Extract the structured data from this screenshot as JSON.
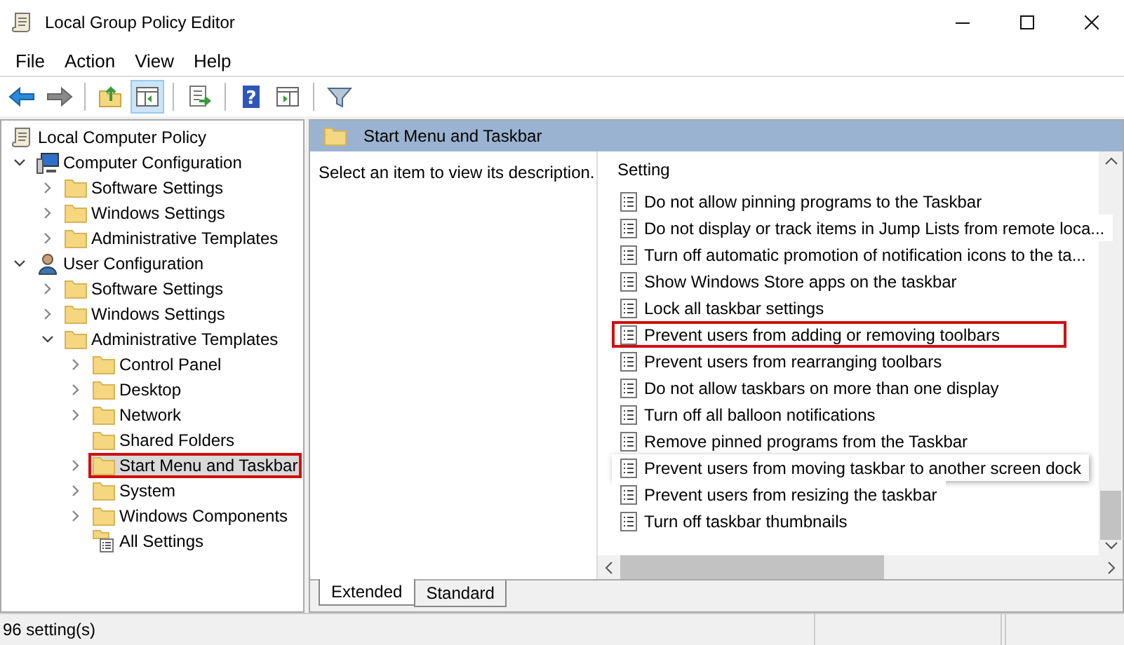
{
  "window": {
    "title": "Local Group Policy Editor"
  },
  "menu": [
    "File",
    "Action",
    "View",
    "Help"
  ],
  "toolbar": [
    {
      "kind": "back",
      "pressed": false
    },
    {
      "kind": "forward",
      "pressed": false
    },
    {
      "kind": "sep"
    },
    {
      "kind": "up",
      "pressed": false
    },
    {
      "kind": "tree",
      "pressed": true
    },
    {
      "kind": "sep"
    },
    {
      "kind": "export",
      "pressed": false
    },
    {
      "kind": "sep"
    },
    {
      "kind": "help",
      "pressed": false,
      "glyph": "?"
    },
    {
      "kind": "pane",
      "pressed": false
    },
    {
      "kind": "sep"
    },
    {
      "kind": "filter",
      "pressed": false
    }
  ],
  "tree": [
    {
      "label": "Local Computer Policy",
      "kind": "policy",
      "expandable": false,
      "selected": false,
      "highlighted": false,
      "children": [
        {
          "label": "Computer Configuration",
          "kind": "computer",
          "expandable": true,
          "expanded": true,
          "selected": false,
          "highlighted": false,
          "children": [
            {
              "label": "Software Settings",
              "kind": "folder",
              "expandable": true,
              "expanded": false,
              "selected": false,
              "highlighted": false
            },
            {
              "label": "Windows Settings",
              "kind": "folder",
              "expandable": true,
              "expanded": false,
              "selected": false,
              "highlighted": false
            },
            {
              "label": "Administrative Templates",
              "kind": "folder",
              "expandable": true,
              "expanded": false,
              "selected": false,
              "highlighted": false
            }
          ]
        },
        {
          "label": "User Configuration",
          "kind": "user",
          "expandable": true,
          "expanded": true,
          "selected": false,
          "highlighted": false,
          "children": [
            {
              "label": "Software Settings",
              "kind": "folder",
              "expandable": true,
              "expanded": false,
              "selected": false,
              "highlighted": false
            },
            {
              "label": "Windows Settings",
              "kind": "folder",
              "expandable": true,
              "expanded": false,
              "selected": false,
              "highlighted": false
            },
            {
              "label": "Administrative Templates",
              "kind": "folder",
              "expandable": true,
              "expanded": true,
              "selected": false,
              "highlighted": false,
              "children": [
                {
                  "label": "Control Panel",
                  "kind": "folder",
                  "expandable": true,
                  "expanded": false,
                  "selected": false,
                  "highlighted": false
                },
                {
                  "label": "Desktop",
                  "kind": "folder",
                  "expandable": true,
                  "expanded": false,
                  "selected": false,
                  "highlighted": false
                },
                {
                  "label": "Network",
                  "kind": "folder",
                  "expandable": true,
                  "expanded": false,
                  "selected": false,
                  "highlighted": false
                },
                {
                  "label": "Shared Folders",
                  "kind": "folder",
                  "expandable": false,
                  "selected": false,
                  "highlighted": false
                },
                {
                  "label": "Start Menu and Taskbar",
                  "kind": "folder",
                  "expandable": true,
                  "expanded": false,
                  "selected": true,
                  "highlighted": true
                },
                {
                  "label": "System",
                  "kind": "folder",
                  "expandable": true,
                  "expanded": false,
                  "selected": false,
                  "highlighted": false
                },
                {
                  "label": "Windows Components",
                  "kind": "folder",
                  "expandable": true,
                  "expanded": false,
                  "selected": false,
                  "highlighted": false
                },
                {
                  "label": "All Settings",
                  "kind": "settings",
                  "expandable": false,
                  "selected": false,
                  "highlighted": false
                }
              ]
            }
          ]
        }
      ]
    }
  ],
  "pane": {
    "title": "Start Menu and Taskbar",
    "description": "Select an item to view its description.",
    "column": "Setting",
    "settings": [
      {
        "label": "Do not allow pinning programs to the Taskbar",
        "highlighted": false,
        "tooltip": false
      },
      {
        "label": "Do not display or track items in Jump Lists from remote loca...",
        "highlighted": false,
        "tooltip": false
      },
      {
        "label": "Turn off automatic promotion of notification icons to the ta...",
        "highlighted": false,
        "tooltip": false
      },
      {
        "label": "Show Windows Store apps on the taskbar",
        "highlighted": false,
        "tooltip": false
      },
      {
        "label": "Lock all taskbar settings",
        "highlighted": false,
        "tooltip": false
      },
      {
        "label": "Prevent users from adding or removing toolbars",
        "highlighted": true,
        "tooltip": false
      },
      {
        "label": "Prevent users from rearranging toolbars",
        "highlighted": false,
        "tooltip": false
      },
      {
        "label": "Do not allow taskbars on more than one display",
        "highlighted": false,
        "tooltip": false
      },
      {
        "label": "Turn off all balloon notifications",
        "highlighted": false,
        "tooltip": false
      },
      {
        "label": "Remove pinned programs from the Taskbar",
        "highlighted": false,
        "tooltip": false
      },
      {
        "label": "Prevent users from moving taskbar to another screen dock",
        "highlighted": false,
        "tooltip": true
      },
      {
        "label": "Prevent users from resizing the taskbar",
        "highlighted": false,
        "tooltip": false
      },
      {
        "label": "Turn off taskbar thumbnails",
        "highlighted": false,
        "tooltip": false
      }
    ],
    "tabs": [
      {
        "label": "Extended",
        "selected": true
      },
      {
        "label": "Standard",
        "selected": false
      }
    ]
  },
  "status_bar": "96 setting(s)"
}
